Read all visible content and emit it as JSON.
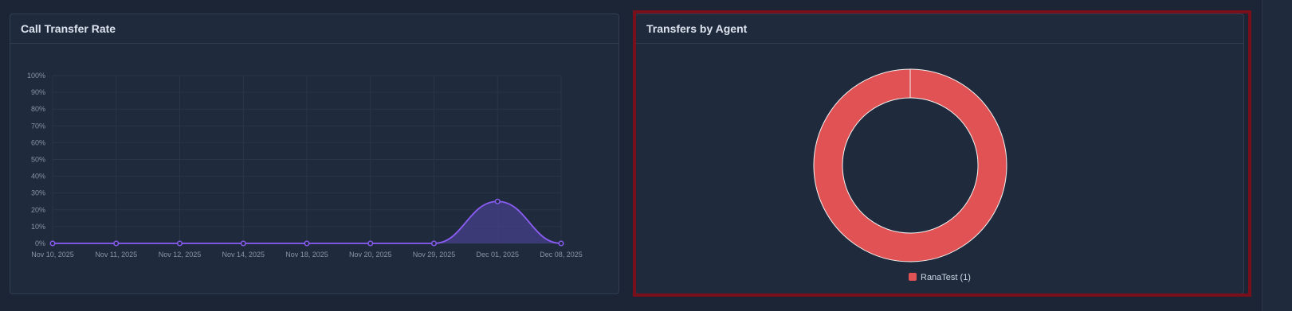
{
  "left_card": {
    "title": "Call Transfer Rate"
  },
  "right_card": {
    "title": "Transfers by Agent"
  },
  "colors": {
    "line": "#8b5cf6",
    "area_fill": "#46408a",
    "donut": "#e05253",
    "donut_border": "#f2f2f2",
    "tick_text": "#8893a5",
    "grid": "#2a3547"
  },
  "chart_data": [
    {
      "type": "area",
      "title": "Call Transfer Rate",
      "categories": [
        "Nov 10, 2025",
        "Nov 11, 2025",
        "Nov 12, 2025",
        "Nov 14, 2025",
        "Nov 18, 2025",
        "Nov 20, 2025",
        "Nov 29, 2025",
        "Dec 01, 2025",
        "Dec 08, 2025"
      ],
      "y_ticks": [
        "100%",
        "90%",
        "80%",
        "70%",
        "60%",
        "50%",
        "40%",
        "30%",
        "20%",
        "10%",
        "0%"
      ],
      "values": [
        0,
        0,
        0,
        0,
        0,
        0,
        0,
        25,
        0
      ],
      "ylim": [
        0,
        100
      ],
      "grid": true
    },
    {
      "type": "pie",
      "title": "Transfers by Agent",
      "labels": [
        "RanaTest"
      ],
      "values": [
        1
      ],
      "legend_labels": [
        "RanaTest (1)"
      ],
      "legend_position": "bottom"
    }
  ]
}
